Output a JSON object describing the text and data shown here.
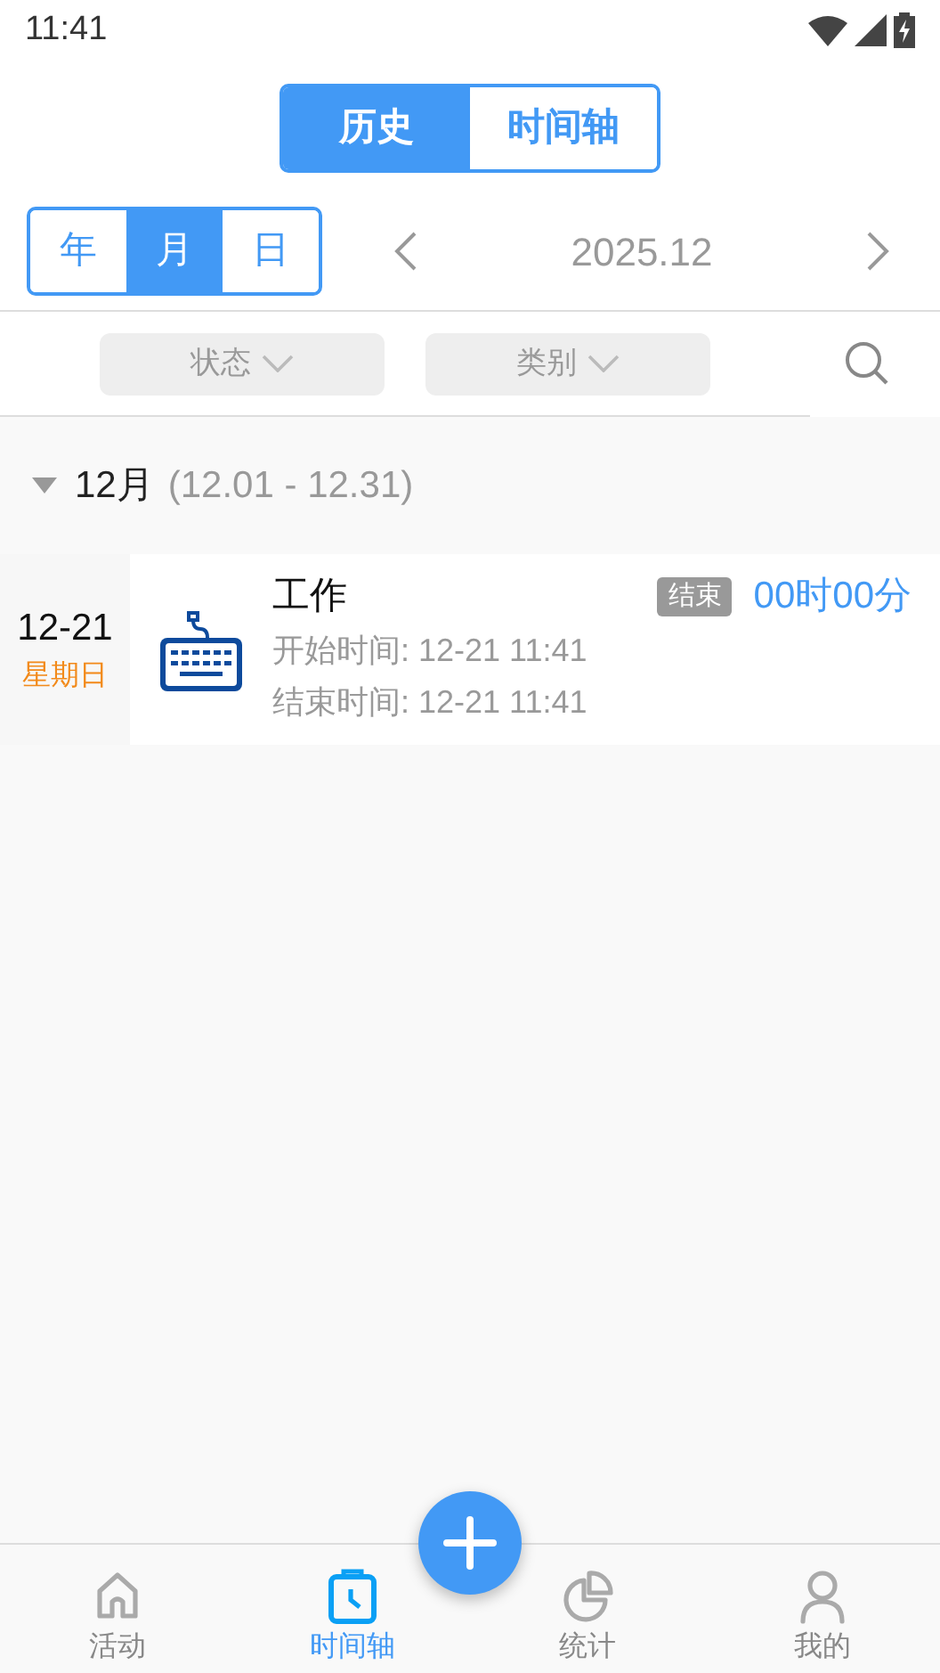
{
  "status_bar": {
    "time": "11:41"
  },
  "view_tabs": [
    {
      "label": "历史",
      "selected": true
    },
    {
      "label": "时间轴",
      "selected": false
    }
  ],
  "period_tabs": [
    {
      "label": "年",
      "selected": false
    },
    {
      "label": "月",
      "selected": true
    },
    {
      "label": "日",
      "selected": false
    }
  ],
  "period": {
    "label": "2025.12"
  },
  "filters": [
    {
      "label": "状态"
    },
    {
      "label": "类别"
    }
  ],
  "groups": [
    {
      "title": "12月",
      "range": "(12.01 - 12.31)",
      "expanded": true,
      "entries": [
        {
          "date": "12-21",
          "weekday": "星期日",
          "name": "工作",
          "status": "结束",
          "duration": "00时00分",
          "start": "开始时间: 12-21 11:41",
          "end": "结束时间: 12-21 11:41"
        }
      ]
    }
  ],
  "nav": [
    {
      "label": "活动",
      "kind": "home",
      "selected": false
    },
    {
      "label": "时间轴",
      "kind": "clock",
      "selected": true
    },
    {
      "label": "统计",
      "kind": "pie",
      "selected": false
    },
    {
      "label": "我的",
      "kind": "person",
      "selected": false
    }
  ]
}
